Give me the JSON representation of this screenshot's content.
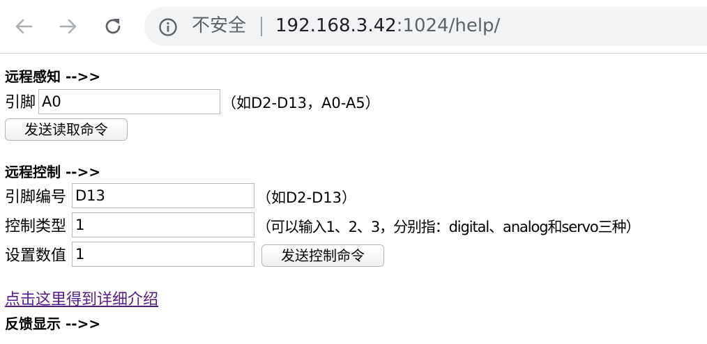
{
  "browser": {
    "security_label": "不安全",
    "url_host": "192.168.3.42",
    "url_rest": ":1024/help/"
  },
  "sensing": {
    "heading": "远程感知 -->>",
    "pin_label": "引脚",
    "pin_value": "A0",
    "pin_hint": "（如D2-D13，A0-A5）",
    "send_button": "发送读取命令"
  },
  "control": {
    "heading": "远程控制 -->>",
    "pin_label": "引脚编号",
    "pin_value": "D13",
    "pin_hint": "（如D2-D13）",
    "type_label": "控制类型",
    "type_value": "1",
    "type_hint": "（可以输入1、2、3，分别指：digital、analog和servo三种）",
    "value_label": "设置数值",
    "value_value": "1",
    "send_button": "发送控制命令"
  },
  "detail_link": "点击这里得到详细介绍",
  "feedback": {
    "heading": "反馈显示 -->>"
  }
}
